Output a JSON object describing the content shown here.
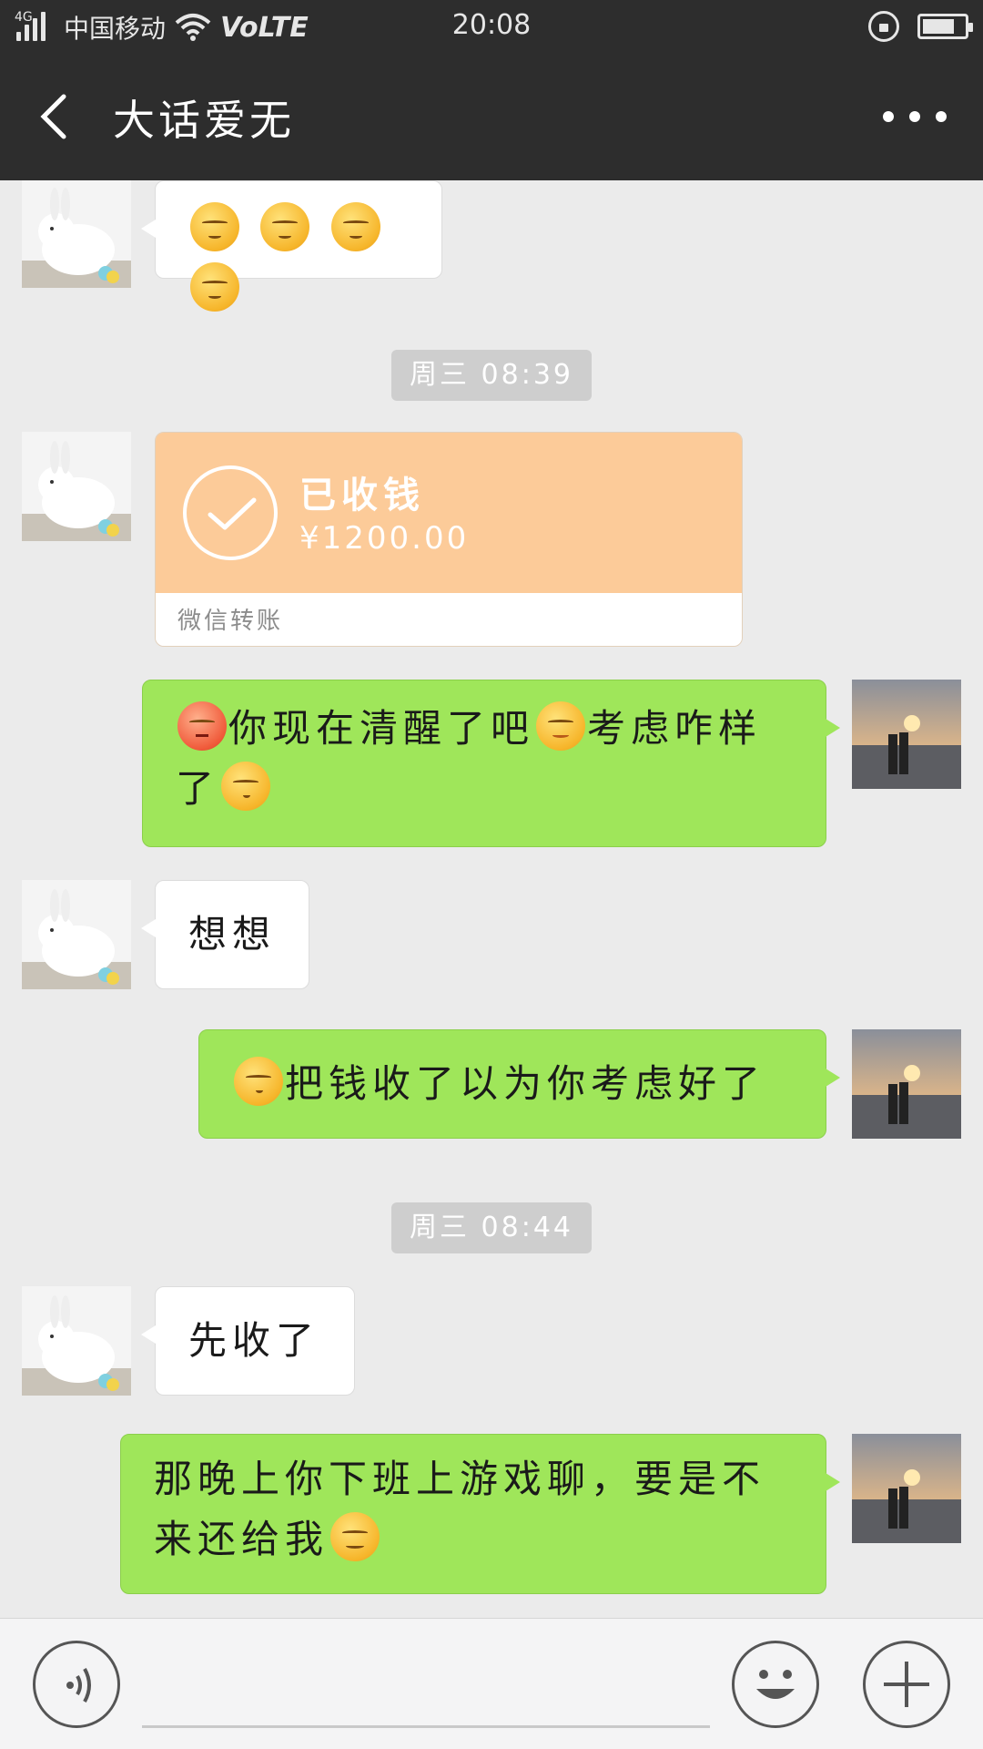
{
  "status_bar": {
    "network": "4G",
    "carrier": "中国移动",
    "volte": "VoLTE",
    "time": "20:08"
  },
  "header": {
    "title": "大话爱无",
    "back_icon": "chevron-left-icon",
    "more_icon": "more-dots-icon"
  },
  "messages": [
    {
      "id": "m1",
      "side": "left",
      "type": "emoji-only",
      "emojis": [
        "sleepy-face-emoji",
        "sleepy-face-emoji",
        "sleepy-face-emoji",
        "sleepy-face-emoji"
      ]
    },
    {
      "id": "t1",
      "type": "timestamp",
      "text": "周三 08:39"
    },
    {
      "id": "m2",
      "side": "left",
      "type": "transfer",
      "status": "已收钱",
      "amount": "¥1200.00",
      "label": "微信转账"
    },
    {
      "id": "m3",
      "side": "right",
      "type": "text",
      "line1": "你现在清醒了吧",
      "line1b": "考虑咋样",
      "line2": "了"
    },
    {
      "id": "m4",
      "side": "left",
      "type": "text",
      "text": "想想"
    },
    {
      "id": "m5",
      "side": "right",
      "type": "text",
      "text": "把钱收了以为你考虑好了"
    },
    {
      "id": "t2",
      "type": "timestamp",
      "text": "周三 08:44"
    },
    {
      "id": "m6",
      "side": "left",
      "type": "text",
      "text": "先收了"
    },
    {
      "id": "m7",
      "side": "right",
      "type": "text",
      "line1": "那晚上你下班上游戏聊，要是不",
      "line2": "来还给我"
    }
  ],
  "input_bar": {
    "placeholder": "",
    "voice_icon": "voice-icon",
    "emoji_icon": "emoji-icon",
    "plus_icon": "plus-icon"
  },
  "colors": {
    "header_bg": "#2d2d2d",
    "chat_bg": "#ebebeb",
    "green_bubble": "#9fe65a",
    "transfer_bg": "#fccb99"
  }
}
